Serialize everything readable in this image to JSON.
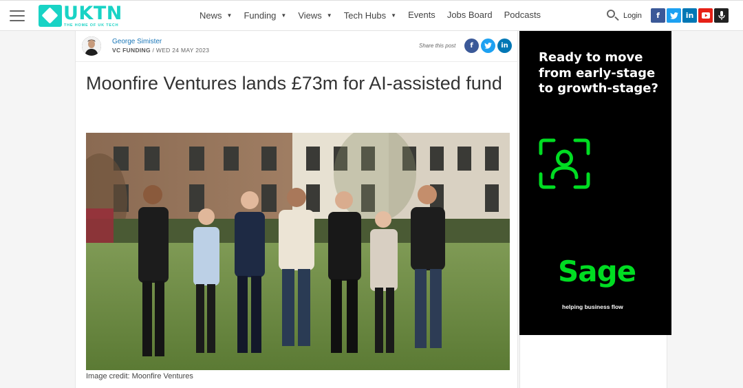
{
  "header": {
    "logo_text": "UKTN",
    "logo_tagline": "THE HOME OF UK TECH",
    "nav": [
      {
        "label": "News",
        "dropdown": true
      },
      {
        "label": "Funding",
        "dropdown": true
      },
      {
        "label": "Views",
        "dropdown": true
      },
      {
        "label": "Tech Hubs",
        "dropdown": true
      },
      {
        "label": "Events",
        "dropdown": false
      },
      {
        "label": "Jobs Board",
        "dropdown": false
      },
      {
        "label": "Podcasts",
        "dropdown": false
      }
    ],
    "login_label": "Login",
    "socials": [
      {
        "name": "facebook-icon",
        "glyph": "f"
      },
      {
        "name": "twitter-icon",
        "glyph": "t"
      },
      {
        "name": "linkedin-icon",
        "glyph": "in"
      },
      {
        "name": "youtube-icon",
        "glyph": "▶"
      },
      {
        "name": "podcast-icon",
        "glyph": "🎙"
      }
    ]
  },
  "article": {
    "author": "George Simister",
    "category": "VC FUNDING",
    "separator": " / ",
    "date": "WED 24 MAY 2023",
    "share_label": "Share this post",
    "headline": "Moonfire Ventures lands £73m for AI-assisted fund",
    "image_caption": "Image credit: Moonfire Ventures"
  },
  "ad": {
    "headline": "Ready to move from early-stage to growth-stage?",
    "brand": "Sage",
    "tagline": "helping business flow",
    "brand_color": "#00dc22"
  },
  "colors": {
    "brand": "#19d3c5",
    "link": "#1976b8",
    "facebook": "#3b5998",
    "twitter": "#1da1f2",
    "linkedin": "#0077b5",
    "youtube": "#e62117"
  }
}
